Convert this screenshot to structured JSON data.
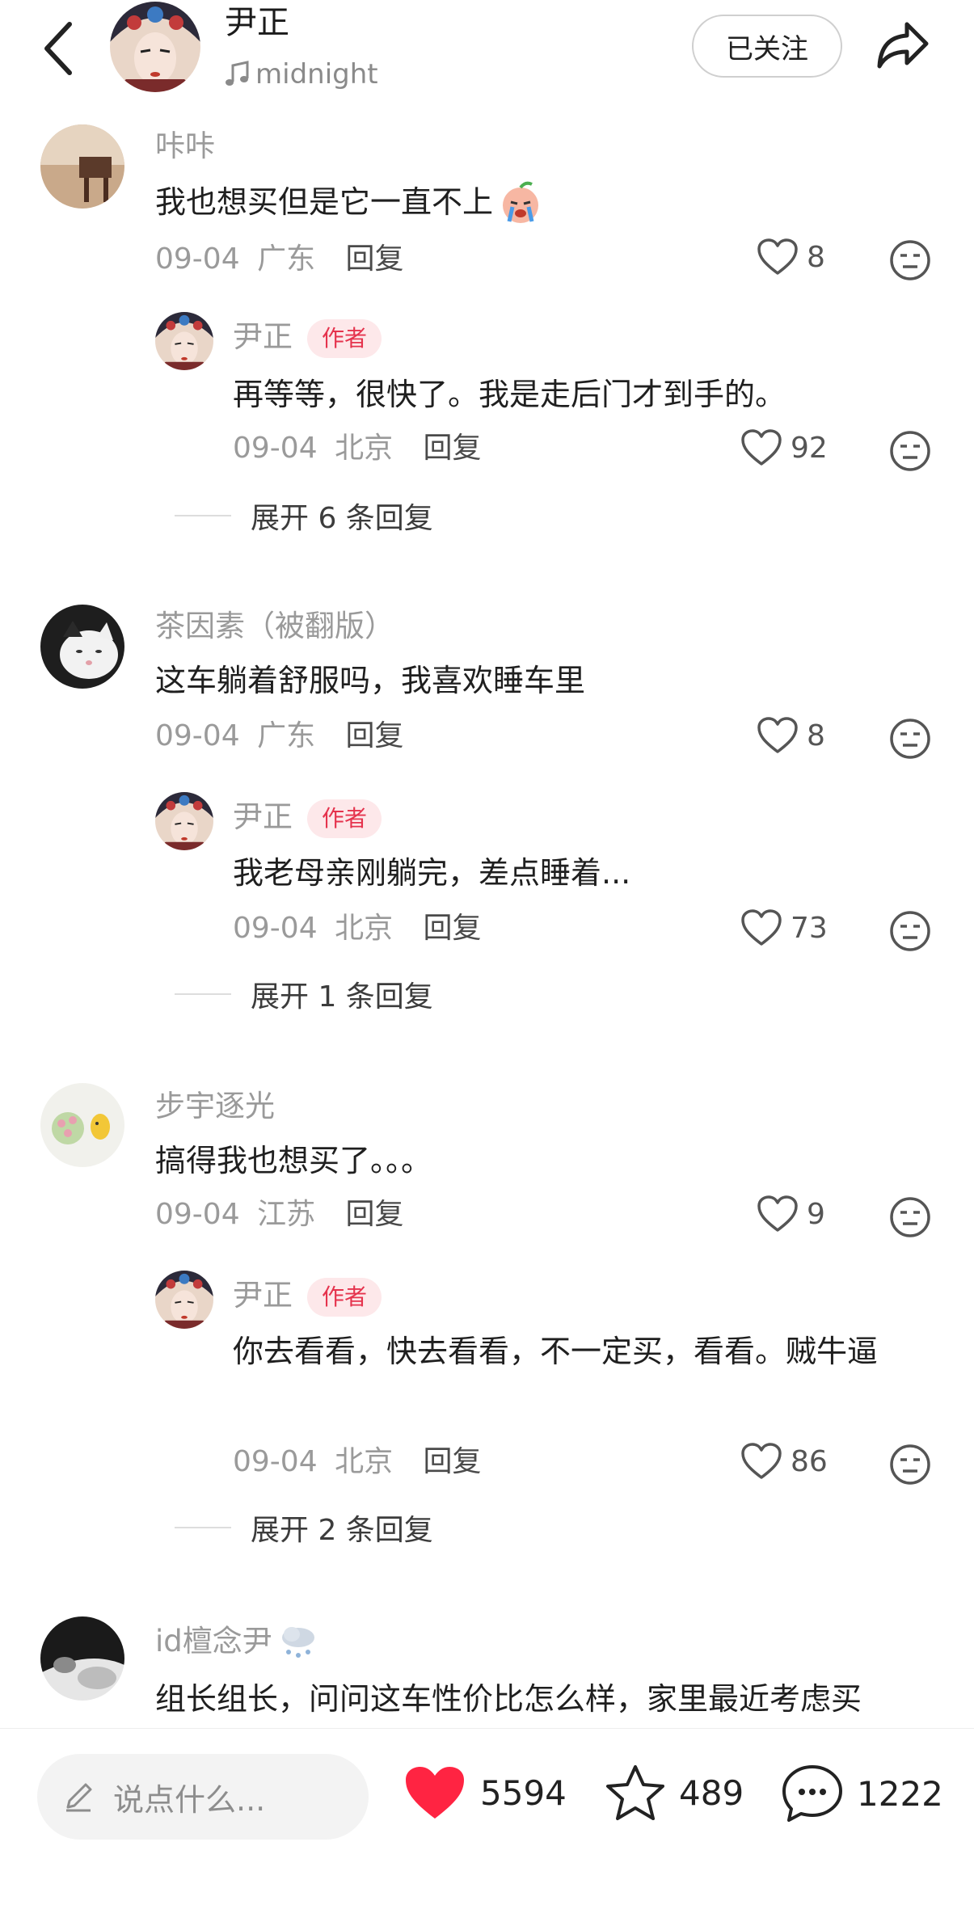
{
  "header": {
    "title": "尹正",
    "music": "midnight",
    "follow_label": "已关注"
  },
  "comments": [
    {
      "user": "咔咔",
      "text": "我也想买但是它一直不上",
      "date": "09-04",
      "location": "广东",
      "reply_label": "回复",
      "likes": "8",
      "reply": {
        "user": "尹正",
        "tag": "作者",
        "text": "再等等，很快了。我是走后门才到手的。",
        "date": "09-04",
        "location": "北京",
        "reply_label": "回复",
        "likes": "92"
      },
      "expand_label": "展开 6 条回复"
    },
    {
      "user": "茶因素（被翻版）",
      "text": "这车躺着舒服吗，我喜欢睡车里",
      "date": "09-04",
      "location": "广东",
      "reply_label": "回复",
      "likes": "8",
      "reply": {
        "user": "尹正",
        "tag": "作者",
        "text": "我老母亲刚躺完，差点睡着...",
        "date": "09-04",
        "location": "北京",
        "reply_label": "回复",
        "likes": "73"
      },
      "expand_label": "展开 1 条回复"
    },
    {
      "user": "步宇逐光",
      "text": "搞得我也想买了。。。",
      "date": "09-04",
      "location": "江苏",
      "reply_label": "回复",
      "likes": "9",
      "reply": {
        "user": "尹正",
        "tag": "作者",
        "text": "你去看看，快去看看，不一定买，看看。贼牛逼",
        "date": "09-04",
        "location": "北京",
        "reply_label": "回复",
        "likes": "86"
      },
      "expand_label": "展开 2 条回复"
    },
    {
      "user": "id檀念尹",
      "text": "组长组长，问问这车性价比怎么样，家里最近考虑买"
    }
  ],
  "bottom": {
    "input_placeholder": "说点什么...",
    "likes": "5594",
    "favorites": "489",
    "comments": "1222"
  },
  "colors": {
    "accent_red": "#ff2442",
    "author_tag_bg": "#fde8ea",
    "author_tag_text": "#e5334d",
    "muted_text": "#9a9a9a"
  }
}
